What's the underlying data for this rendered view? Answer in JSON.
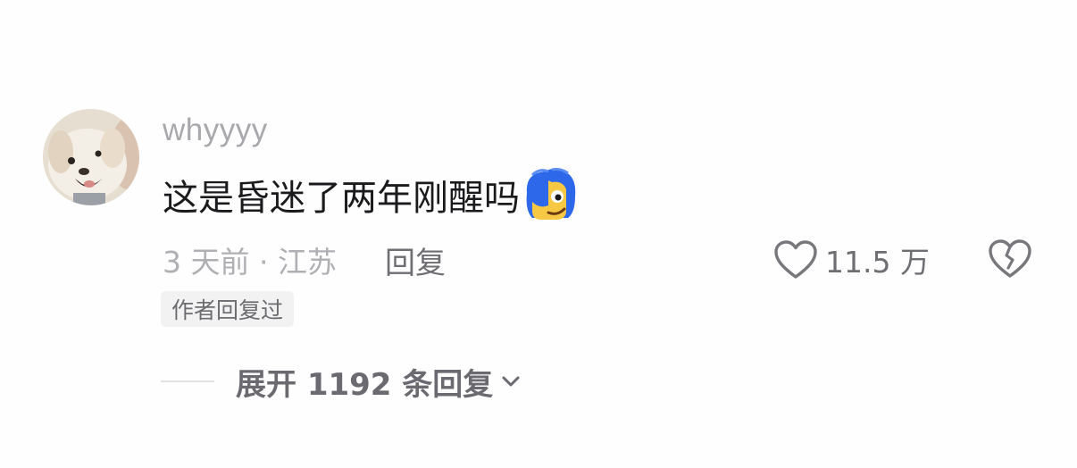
{
  "comment": {
    "username": "whyyyy",
    "avatar_icon": "dog-avatar",
    "text": "这是昏迷了两年刚醒吗",
    "emoji_icon": "blue-hair-face-emoji",
    "meta": "3 天前 · 江苏",
    "reply_label": "回复",
    "likes": "11.5 万",
    "like_icon": "heart-outline-icon",
    "dislike_icon": "broken-heart-icon",
    "author_badge": "作者回复过",
    "expand_replies_label": "展开 1192 条回复",
    "expand_icon": "chevron-down-icon"
  },
  "colors": {
    "background": "#fefefe",
    "text_primary": "#1b1b1d",
    "text_secondary": "#6e6e73",
    "text_muted": "#b0b0b4",
    "badge_bg": "#f2f2f3"
  }
}
